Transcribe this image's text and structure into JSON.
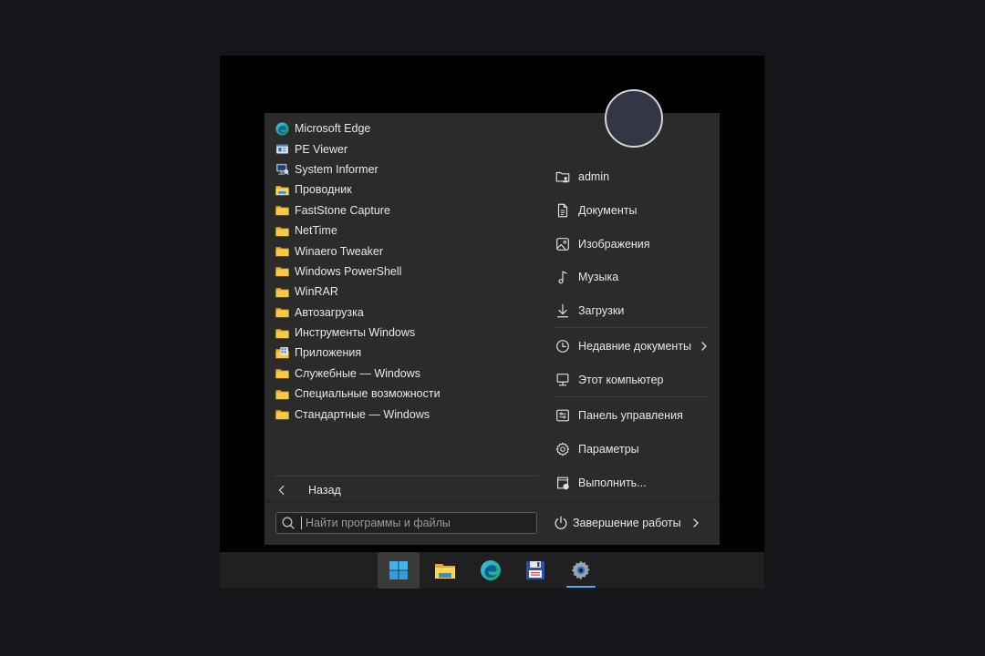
{
  "programs": [
    {
      "label": "Microsoft Edge",
      "icon": "edge-icon"
    },
    {
      "label": "PE Viewer",
      "icon": "pe-viewer-icon"
    },
    {
      "label": "System Informer",
      "icon": "system-informer-icon"
    },
    {
      "label": "Проводник",
      "icon": "explorer-icon"
    },
    {
      "label": "FastStone Capture",
      "icon": "folder-icon"
    },
    {
      "label": "NetTime",
      "icon": "folder-icon"
    },
    {
      "label": "Winaero Tweaker",
      "icon": "folder-icon"
    },
    {
      "label": "Windows PowerShell",
      "icon": "folder-icon"
    },
    {
      "label": "WinRAR",
      "icon": "folder-icon"
    },
    {
      "label": "Автозагрузка",
      "icon": "folder-icon"
    },
    {
      "label": "Инструменты Windows",
      "icon": "folder-icon"
    },
    {
      "label": "Приложения",
      "icon": "apps-folder-icon"
    },
    {
      "label": "Служебные — Windows",
      "icon": "folder-icon"
    },
    {
      "label": "Специальные возможности",
      "icon": "folder-icon"
    },
    {
      "label": "Стандартные — Windows",
      "icon": "folder-icon"
    }
  ],
  "back_label": "Назад",
  "places": {
    "user": "admin",
    "documents": "Документы",
    "pictures": "Изображения",
    "music": "Музыка",
    "downloads": "Загрузки",
    "recent": "Недавние документы",
    "computer": "Этот компьютер",
    "control_panel": "Панель управления",
    "settings": "Параметры",
    "run": "Выполнить..."
  },
  "search": {
    "placeholder": "Найти программы и файлы"
  },
  "shutdown_label": "Завершение работы",
  "taskbar": {
    "items": [
      "start-icon",
      "file-explorer-icon",
      "edge-icon",
      "floppy-disk-icon",
      "settings-gear-icon"
    ],
    "accent": "#5aa9e6"
  },
  "colors": {
    "menu_bg": "#2b2b2b",
    "taskbar_bg": "#202020",
    "folder_yellow": "#f7c948",
    "text": "#e8e8e8"
  }
}
